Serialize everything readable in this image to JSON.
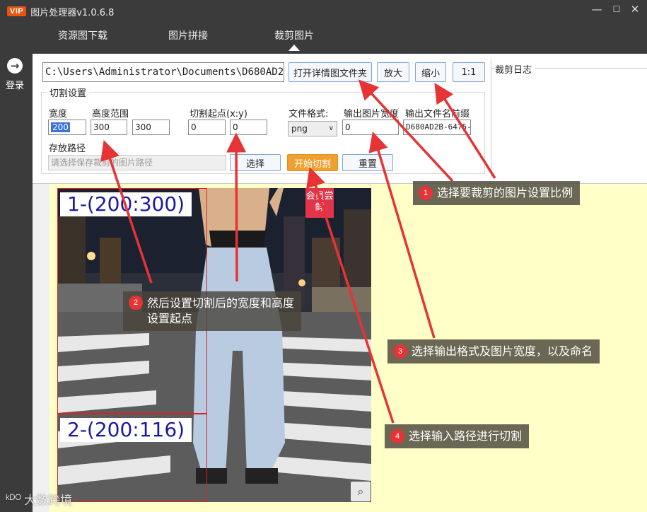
{
  "app": {
    "title": "图片处理器v1.0.6.8",
    "vip_badge": "VIP"
  },
  "window_controls": {
    "minimize": "—",
    "maximize": "☐",
    "close": "✕"
  },
  "tabs": [
    {
      "label": "资源图下载"
    },
    {
      "label": "图片拼接"
    },
    {
      "label": "裁剪图片",
      "active": true
    }
  ],
  "sidebar": {
    "login_label": "登录",
    "login_icon": "→"
  },
  "toolbar": {
    "path_value": "C:\\Users\\Administrator\\Documents\\D680AD2",
    "open_folder": "打开详情图文件夹",
    "zoom_in": "放大",
    "zoom_out": "缩小",
    "ratio_1_1": "1:1"
  },
  "log": {
    "title": "裁剪日志"
  },
  "cut_settings": {
    "legend": "切割设置",
    "width_label": "宽度",
    "width_value": "200",
    "height_label": "高度范围",
    "height_min": "300",
    "height_max": "300",
    "start_label": "切割起点(x:y)",
    "start_x": "0",
    "start_y": "0",
    "format_label": "文件格式:",
    "format_value": "png",
    "out_width_label": "输出图片宽度",
    "out_width_value": "0",
    "prefix_label": "输出文件名前缀",
    "prefix_value": "D680AD2B-6475-",
    "save_path_label": "存放路径",
    "save_path_placeholder": "请选择保存裁剪的图片路径",
    "choose": "选择",
    "start_cut": "开始切割",
    "reset": "重置"
  },
  "preview": {
    "crop1": "1-(200:300)",
    "crop2": "2-(200:116)",
    "corner_tag": "会员尝鲜",
    "zoom_icon": "⌕"
  },
  "callouts": [
    {
      "n": "1",
      "text": "选择要裁剪的图片设置比例"
    },
    {
      "n": "2",
      "text": "然后设置切割后的宽度和高度设置起点"
    },
    {
      "n": "3",
      "text": "选择输出格式及图片宽度，以及命名"
    },
    {
      "n": "4",
      "text": "选择输入路径进行切割"
    }
  ],
  "watermark": {
    "mark": "ᵏᴰᴼ",
    "text": "大数跨境"
  },
  "colors": {
    "accent": "#f0a030",
    "callout_badge": "#e63335",
    "arrow": "#e63335",
    "crop": "#e02020"
  }
}
